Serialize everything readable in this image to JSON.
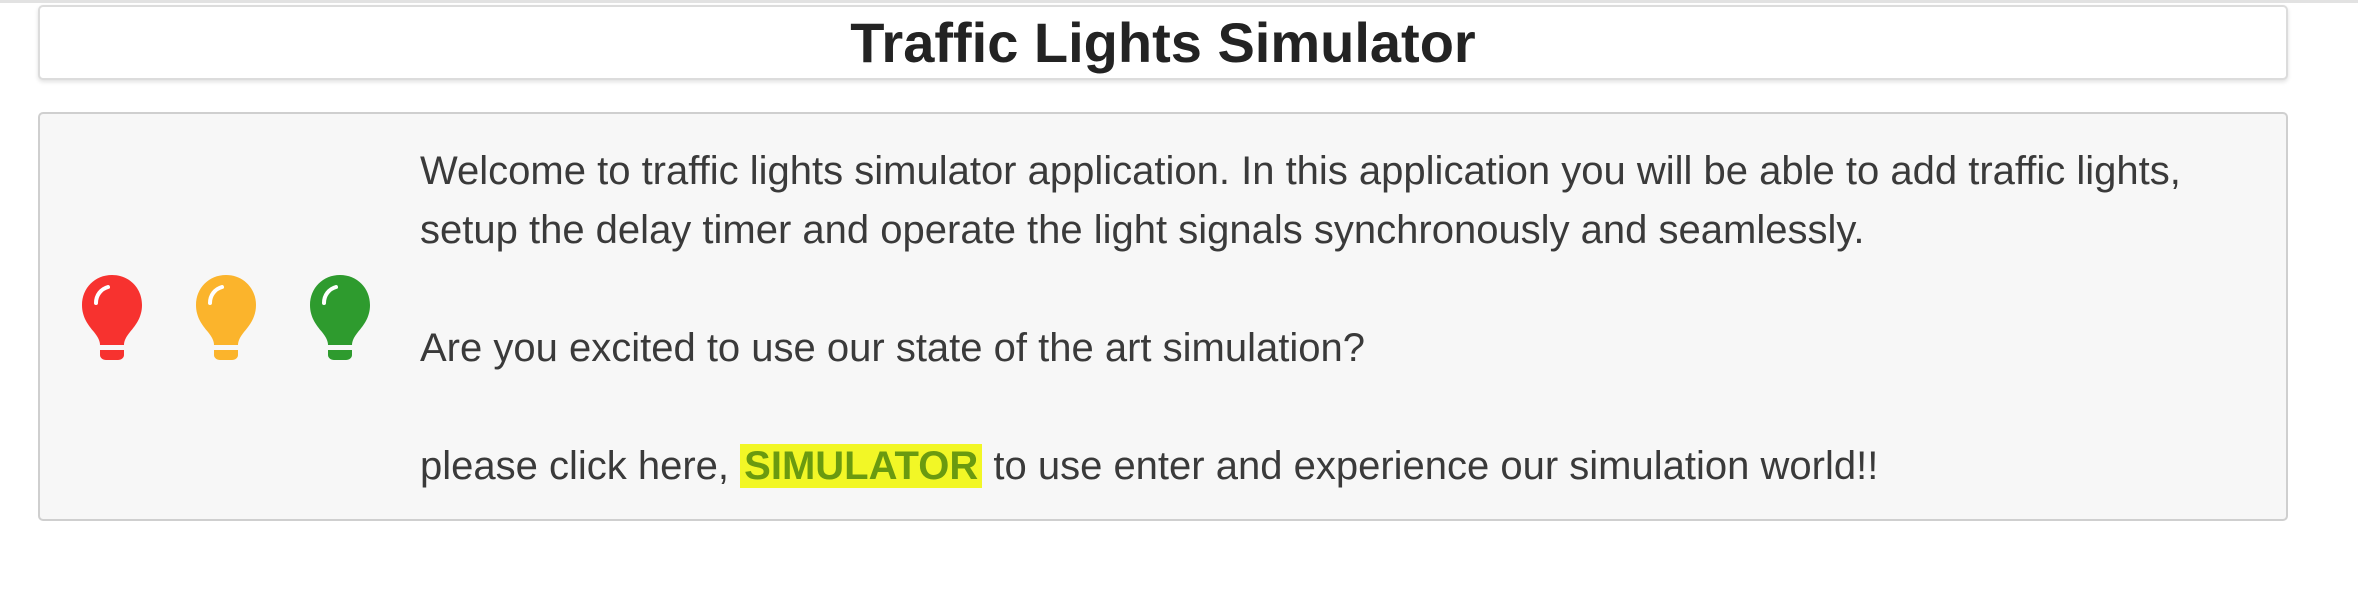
{
  "header": {
    "title": "Traffic Lights Simulator"
  },
  "lights": [
    {
      "color": "#f7322f",
      "icon": "lightbulb-icon"
    },
    {
      "color": "#fbb42c",
      "icon": "lightbulb-icon"
    },
    {
      "color": "#2e9b2e",
      "icon": "lightbulb-icon"
    }
  ],
  "intro": {
    "welcome_text": "Welcome to traffic lights simulator application. In this application you will be able to add traffic lights, setup the delay timer and operate the light signals synchronously and seamlessly.",
    "question_text": "Are you excited to use our state of the art simulation?",
    "cta_prefix": "please click here,",
    "cta_link_label": "SIMULATOR",
    "cta_suffix": "to use enter and experience our simulation world!!"
  },
  "colors": {
    "link_text": "#6a9a10",
    "link_highlight": "#f2f726",
    "card_background": "#f7f7f7"
  }
}
